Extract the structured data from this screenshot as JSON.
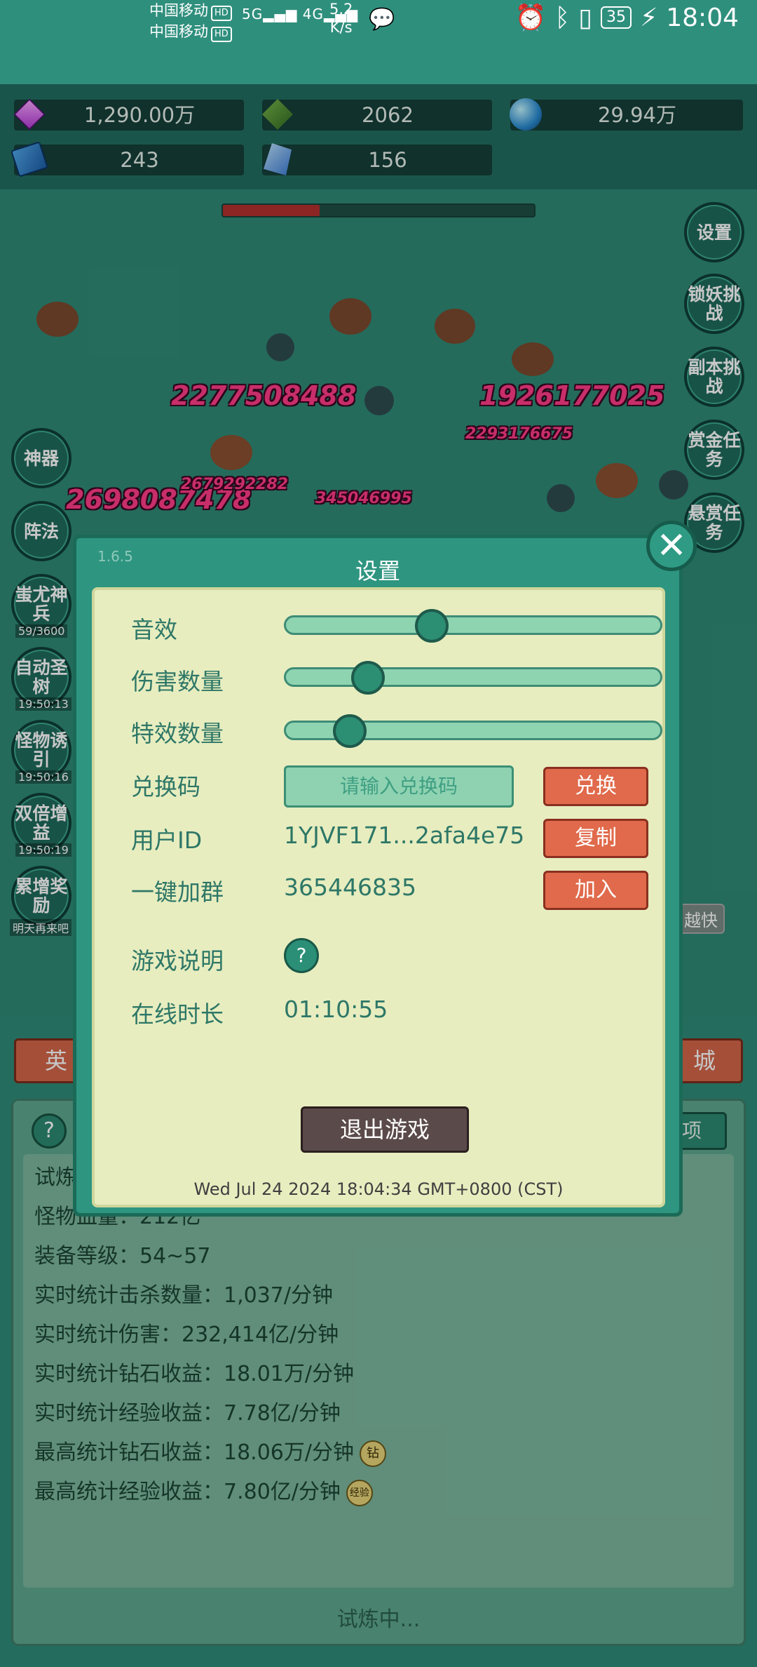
{
  "status_bar": {
    "carrier1": "中国移动",
    "carrier2": "中国移动",
    "hd": "HD",
    "signal1": "5G",
    "signal2": "4G",
    "net_speed_value": "5.2",
    "net_speed_unit": "K/s",
    "battery": "35",
    "time": "18:04"
  },
  "resources": [
    {
      "icon": "purple-gem-icon",
      "value": "1,290.00万"
    },
    {
      "icon": "green-shield-icon",
      "value": "2062"
    },
    {
      "icon": "blue-orb-icon",
      "value": "29.94万"
    },
    {
      "icon": "blue-book-icon",
      "value": "243"
    },
    {
      "icon": "blue-crystal-icon",
      "value": "156"
    }
  ],
  "boss_hp_fraction": 0.31,
  "right_menu": [
    "设置",
    "锁妖挑战",
    "副本挑战",
    "赏金任务",
    "悬赏任务"
  ],
  "left_menu": [
    {
      "label": "神器",
      "sub": ""
    },
    {
      "label": "阵法",
      "sub": ""
    },
    {
      "label": "蚩尤神兵",
      "sub": "59/3600"
    },
    {
      "label": "自动圣树",
      "sub": "19:50:13"
    },
    {
      "label": "怪物诱引",
      "sub": "19:50:16"
    },
    {
      "label": "双倍增益",
      "sub": "19:50:19"
    },
    {
      "label": "累增奖励",
      "sub": "明天再来吧"
    }
  ],
  "damage_numbers": [
    "2277508488",
    "1926177025",
    "2698087478",
    "2293176675",
    "345046995",
    "2679292282"
  ],
  "bottom": {
    "left_tab": "英",
    "right_tab": "城",
    "faster_label": "越快",
    "option_label": "项",
    "trial_label": "试炼",
    "stats": [
      "怪物血量：212亿",
      "装备等级：54~57",
      "实时统计击杀数量：1,037/分钟",
      "实时统计伤害：232,414亿/分钟",
      "实时统计钻石收益：18.01万/分钟",
      "实时统计经验收益：7.78亿/分钟",
      "最高统计钻石收益：18.06万/分钟",
      "最高统计经验收益：7.80亿/分钟"
    ],
    "badge_diamond": "钻",
    "badge_exp": "经验",
    "trial_status": "试炼中..."
  },
  "settings": {
    "version": "1.6.5",
    "title": "设置",
    "sound_label": "音效",
    "sound_level": 0.39,
    "damage_count_label": "伤害数量",
    "damage_count_level": 0.22,
    "effect_count_label": "特效数量",
    "effect_count_level": 0.17,
    "redeem_label": "兑换码",
    "redeem_placeholder": "请输入兑换码",
    "redeem_button": "兑换",
    "user_id_label": "用户ID",
    "user_id": "1YJVF171...2afa4e75",
    "copy_button": "复制",
    "join_group_label": "一键加群",
    "group_id": "365446835",
    "join_button": "加入",
    "game_help_label": "游戏说明",
    "help_icon": "?",
    "online_time_label": "在线时长",
    "online_time": "01:10:55",
    "exit_button": "退出游戏",
    "datetime": "Wed Jul 24 2024 18:04:34 GMT+0800 (CST)"
  }
}
